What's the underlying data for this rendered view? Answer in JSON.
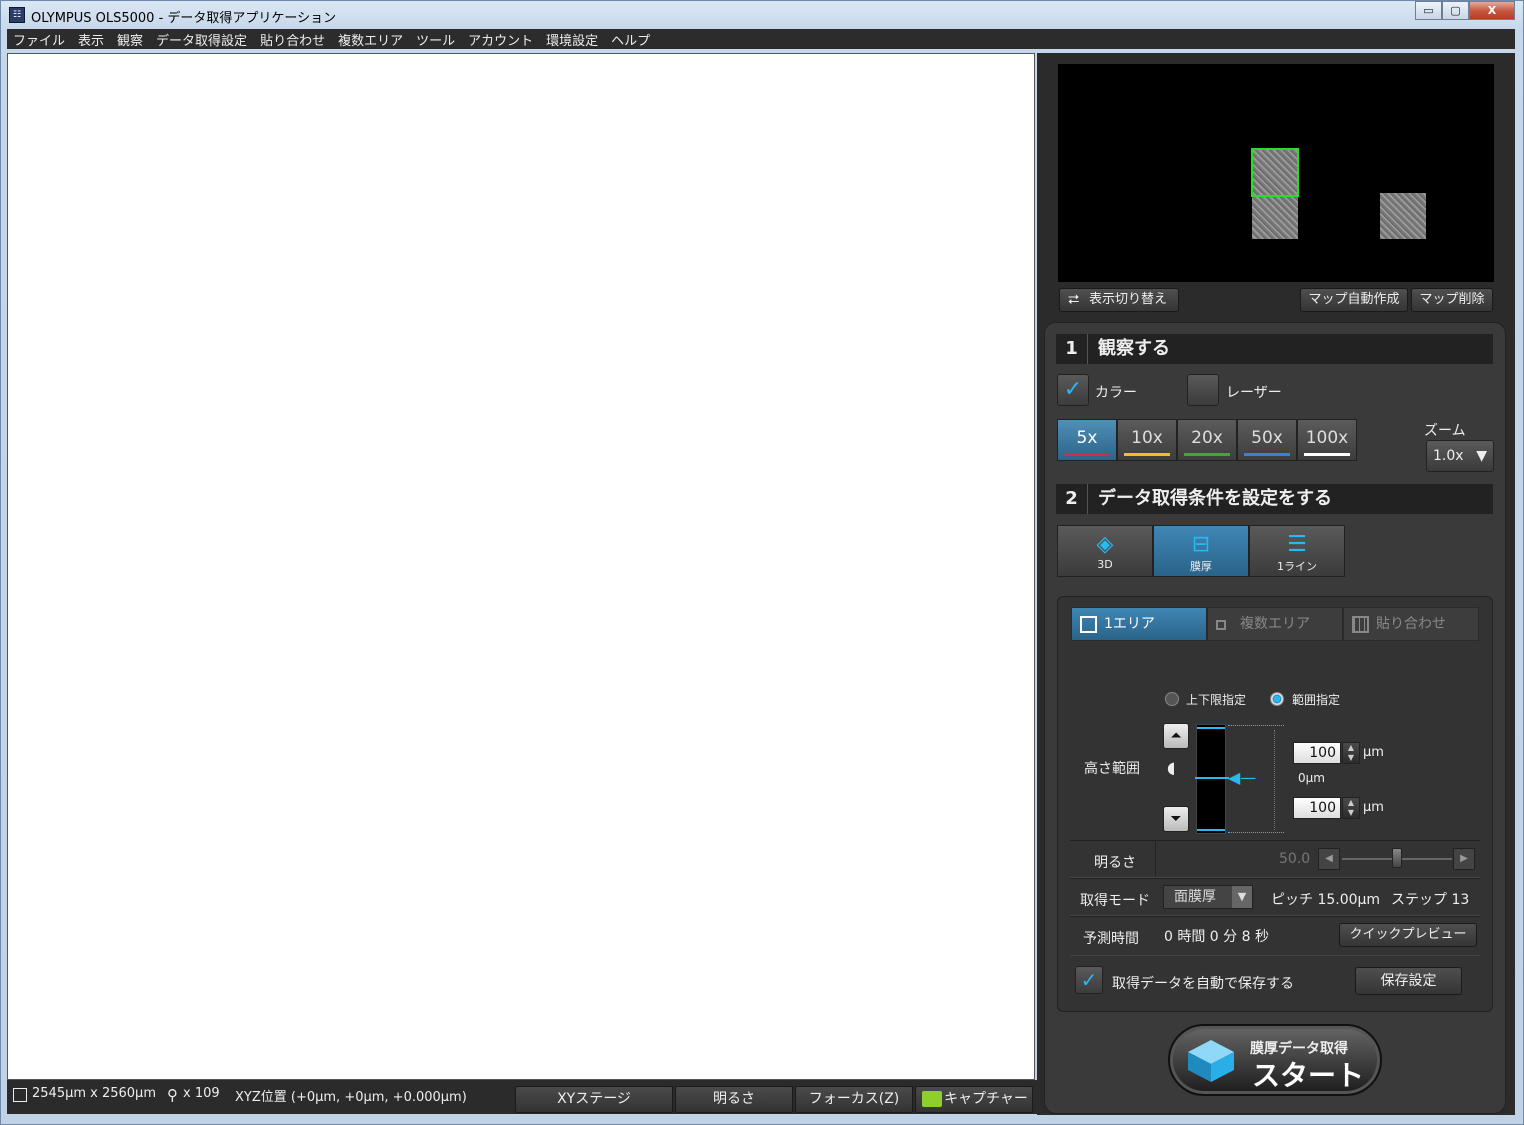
{
  "window": {
    "title": "OLYMPUS OLS5000 - データ取得アプリケーション",
    "app_icon": "olympus-app-icon",
    "minimize": "▭",
    "restore": "▢",
    "close": "X"
  },
  "menu": [
    "ファイル",
    "表示",
    "観察",
    "データ取得設定",
    "貼り合わせ",
    "複数エリア",
    "ツール",
    "アカウント",
    "環境設定",
    "ヘルプ"
  ],
  "status": {
    "field_size": "2545µm x 2560µm",
    "magnification": "x 109",
    "xyz_position": "XYZ位置 (+0µm, +0µm, +0.000µm)"
  },
  "bottom_buttons": {
    "xy_stage": "XYステージ",
    "brightness": "明るさ",
    "focus": "フォーカス(Z)",
    "capture": "キャプチャー"
  },
  "map_panel": {
    "switch_display": "表示切り替え",
    "auto_map": "マップ自動作成",
    "delete_map": "マップ削除"
  },
  "step1": {
    "number": "1",
    "title": "観察する",
    "color_label": "カラー",
    "color_checked": true,
    "laser_label": "レーザー",
    "laser_checked": false,
    "objectives": [
      {
        "label": "5x",
        "color": "#d8245a",
        "selected": true
      },
      {
        "label": "10x",
        "color": "#f0c020",
        "selected": false
      },
      {
        "label": "20x",
        "color": "#4aa040",
        "selected": false
      },
      {
        "label": "50x",
        "color": "#3a7fe0",
        "selected": false
      },
      {
        "label": "100x",
        "color": "#ffffff",
        "selected": false
      }
    ],
    "zoom_label": "ズーム",
    "zoom_value": "1.0x"
  },
  "step2": {
    "number": "2",
    "title": "データ取得条件を設定をする",
    "modes": [
      {
        "label": "3D",
        "icon": "layers-icon",
        "selected": false
      },
      {
        "label": "膜厚",
        "icon": "film-thickness-icon",
        "selected": true
      },
      {
        "label": "1ライン",
        "icon": "line-icon",
        "selected": false
      }
    ],
    "areas": [
      {
        "label": "1エリア",
        "selected": true
      },
      {
        "label": "複数エリア",
        "selected": false
      },
      {
        "label": "貼り合わせ",
        "selected": false
      }
    ],
    "range_mode_upper_lower": "上下限指定",
    "range_mode_range": "範囲指定",
    "height_range_label": "高さ範囲",
    "upper_value": "100",
    "lower_value": "100",
    "unit": "µm",
    "center_label": "0µm",
    "brightness_label": "明るさ",
    "brightness_value": "50.0",
    "acq_mode_label": "取得モード",
    "acq_mode_value": "面膜厚",
    "pitch_text": "ピッチ 15.00µm",
    "step_text": "ステップ 13",
    "est_time_label": "予測時間",
    "est_time_value": "0 時間 0 分 8 秒",
    "quick_preview": "クイックプレビュー",
    "auto_save_label": "取得データを自動で保存する",
    "auto_save_checked": true,
    "save_settings": "保存設定"
  },
  "start_button": {
    "line1": "膜厚データ取得",
    "line2": "スタート"
  },
  "colors": {
    "accent": "#29b8f0",
    "selected_blue": "#2d6389",
    "map_highlight": "#22e022"
  }
}
